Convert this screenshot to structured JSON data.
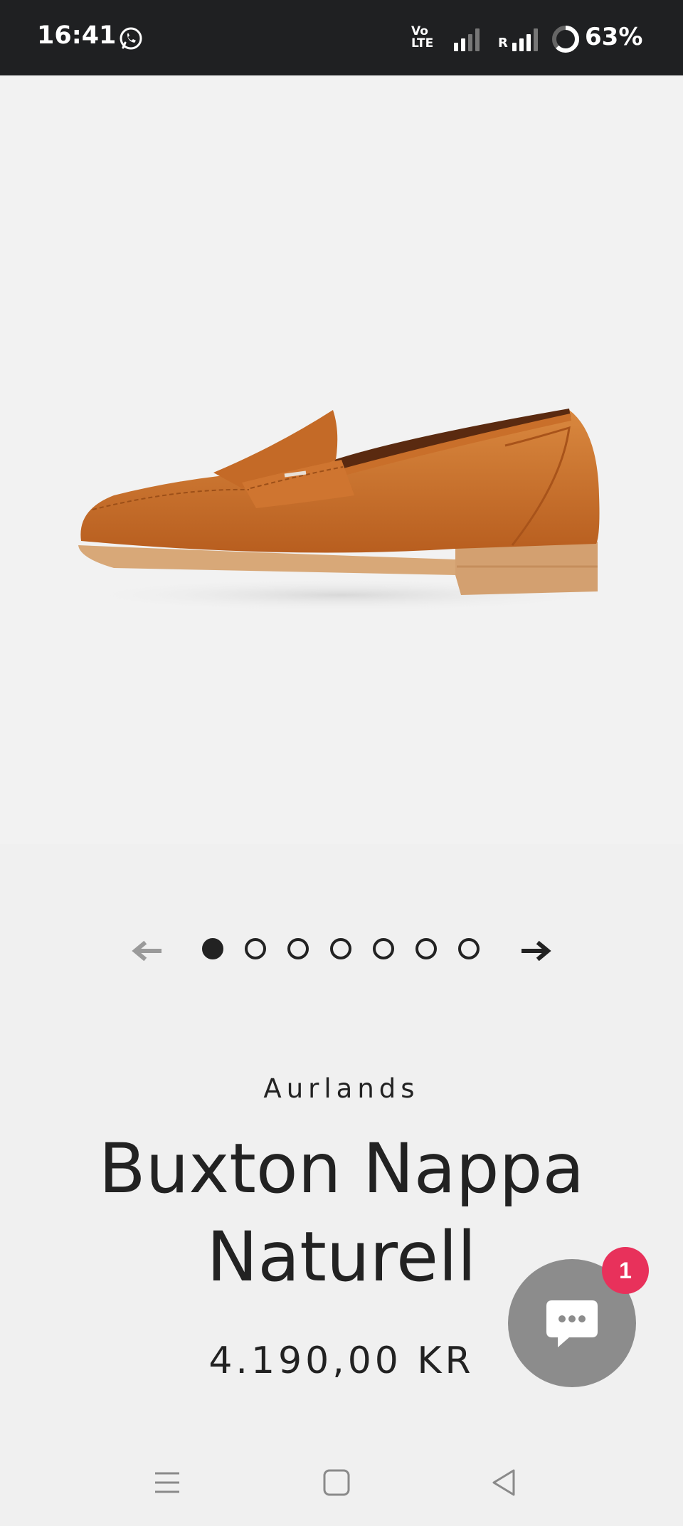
{
  "status_bar": {
    "time": "16:41",
    "volte_top": "Vo",
    "volte_bottom": "LTE",
    "roaming": "R",
    "battery": "63%",
    "icons": [
      "whatsapp-icon",
      "volte-icon",
      "signal-icon",
      "battery-icon"
    ]
  },
  "carousel": {
    "slide_count": 7,
    "active_index": 0,
    "prev_icon": "arrow-left-icon",
    "next_icon": "arrow-right-icon"
  },
  "product": {
    "brand": "Aurlands",
    "title_line1": "Buxton Nappa",
    "title_line2": "Naturell",
    "price": "4.190,00 KR"
  },
  "chat": {
    "badge_count": "1",
    "icon": "chat-bubble-icon"
  },
  "nav": {
    "icons": [
      "menu-icon",
      "home-icon",
      "back-icon"
    ]
  },
  "colors": {
    "status_bar_bg": "#1f2022",
    "page_bg": "#f0f0f0",
    "text": "#222222",
    "badge": "#e8315b",
    "chat_button": "#8c8c8c",
    "shoe_leather": "#c96f2a"
  }
}
